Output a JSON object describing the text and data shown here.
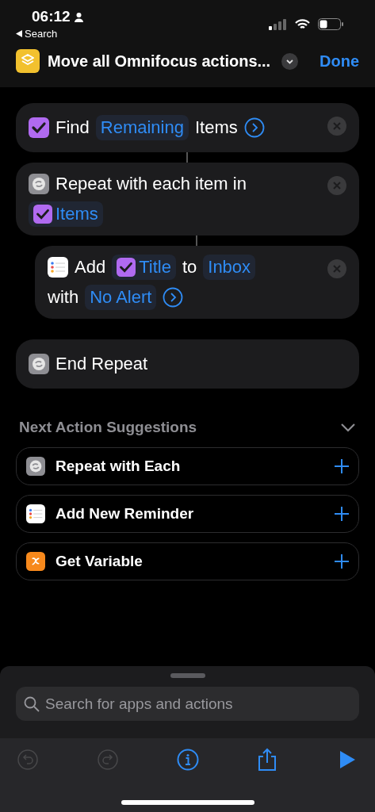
{
  "status_bar": {
    "time": "06:12",
    "back_label": "Search"
  },
  "header": {
    "title": "Move all Omnifocus actions...",
    "done": "Done"
  },
  "actions": [
    {
      "kind": "check",
      "indented": false,
      "lines": [
        [
          {
            "kind": "text",
            "text": "Find"
          },
          {
            "kind": "token",
            "text": "Remaining"
          },
          {
            "kind": "text",
            "text": "Items"
          },
          {
            "kind": "chevron"
          }
        ]
      ]
    },
    {
      "kind": "repeat",
      "indented": false,
      "lines": [
        [
          {
            "kind": "text",
            "text": "Repeat with each item in"
          }
        ],
        [
          {
            "kind": "token",
            "text": "Items",
            "with_icon": true
          }
        ]
      ]
    },
    {
      "kind": "list",
      "indented": true,
      "lines": [
        [
          {
            "kind": "text",
            "text": "Add"
          },
          {
            "kind": "token",
            "text": "Title",
            "with_icon": true
          },
          {
            "kind": "text",
            "text": "to"
          },
          {
            "kind": "token",
            "text": "Inbox"
          }
        ],
        [
          {
            "kind": "text",
            "text": "with"
          },
          {
            "kind": "token",
            "text": "No Alert"
          },
          {
            "kind": "chevron"
          }
        ]
      ]
    },
    {
      "kind": "repeat",
      "indented": false,
      "removable": false,
      "lines": [
        [
          {
            "kind": "text",
            "text": "End Repeat"
          }
        ]
      ]
    }
  ],
  "suggestions": {
    "title": "Next Action Suggestions",
    "expanded": true,
    "items": [
      {
        "kind": "repeat",
        "label": "Repeat with Each"
      },
      {
        "kind": "list",
        "label": "Add New Reminder"
      },
      {
        "kind": "variable",
        "label": "Get Variable"
      }
    ]
  },
  "search": {
    "placeholder": "Search for apps and actions"
  },
  "toolbar": [
    {
      "kind": "undo",
      "disabled": true
    },
    {
      "kind": "redo",
      "disabled": true
    },
    {
      "kind": "info",
      "disabled": false
    },
    {
      "kind": "share",
      "disabled": false
    },
    {
      "kind": "play",
      "disabled": false
    }
  ]
}
